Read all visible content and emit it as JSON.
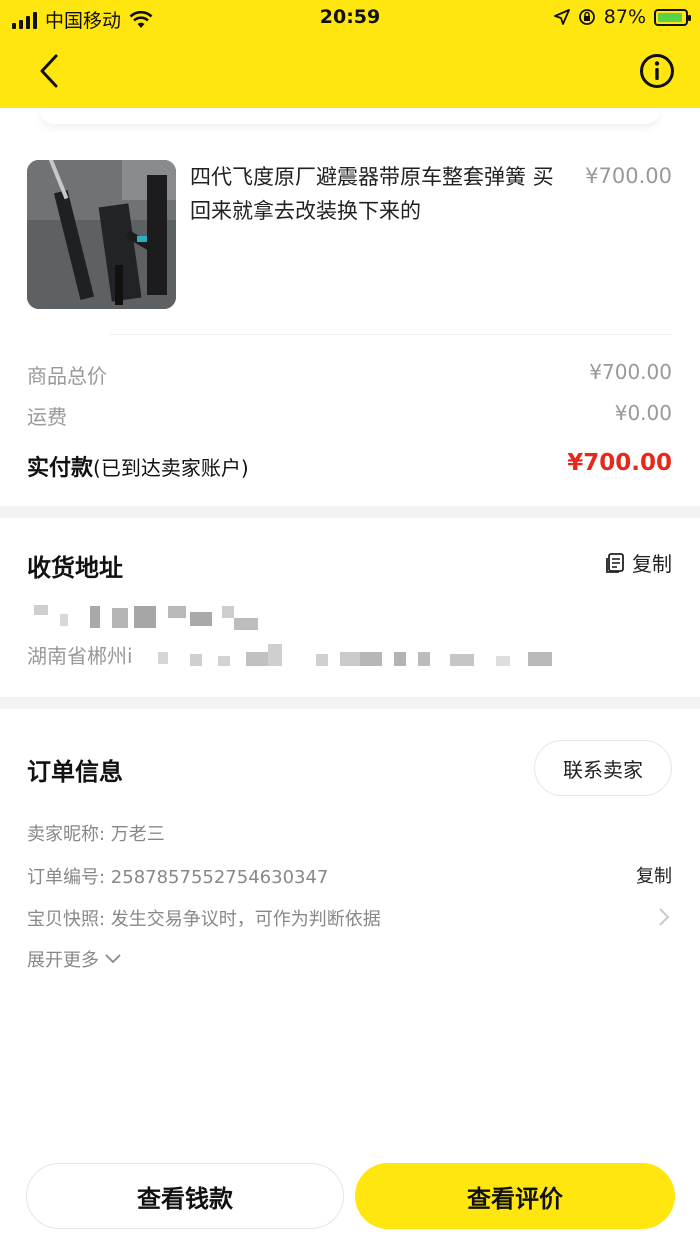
{
  "status_bar": {
    "carrier": "中国移动",
    "time": "20:59",
    "battery": "87%"
  },
  "product": {
    "title": "四代飞度原厂避震器带原车整套弹簧 买回来就拿去改装换下来的",
    "price": "¥700.00"
  },
  "summary": {
    "goods_total_label": "商品总价",
    "goods_total_value": "¥700.00",
    "shipping_label": "运费",
    "shipping_value": "¥0.00",
    "paid_label": "实付款",
    "paid_note": "(已到达卖家账户)",
    "paid_value": "¥700.00"
  },
  "address": {
    "title": "收货地址",
    "copy_label": "复制",
    "line2_prefix": "湖南省郴州i"
  },
  "order": {
    "title": "订单信息",
    "contact_button": "联系卖家",
    "seller_nick": "卖家昵称: 万老三",
    "order_no": "订单编号: 2587857552754630347",
    "copy_label": "复制",
    "snapshot": "宝贝快照: 发生交易争议时，可作为判断依据",
    "expand_more": "展开更多"
  },
  "actions": {
    "view_money": "查看钱款",
    "view_review": "查看评价"
  },
  "colors": {
    "brand_yellow": "#ffe60f",
    "price_red": "#e8281d"
  }
}
